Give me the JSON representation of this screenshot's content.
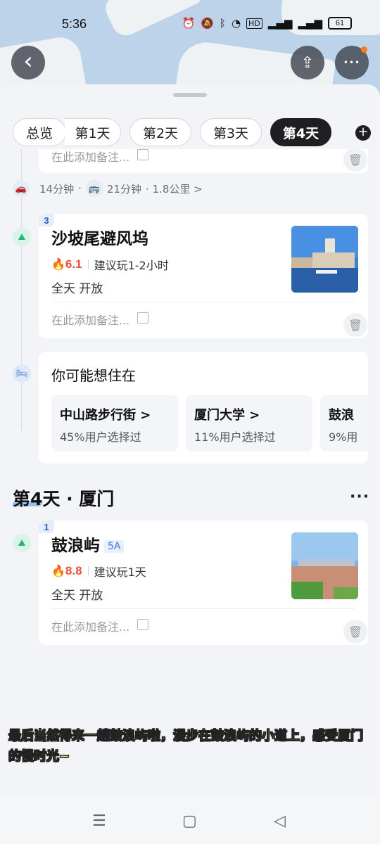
{
  "status_bar": {
    "time": "5:36",
    "icons": [
      "alarm-icon",
      "mute-icon",
      "bluetooth-icon",
      "wifi-icon",
      "hd-icon",
      "4g-signal-icon",
      "5g-signal-icon"
    ],
    "hd": "HD",
    "battery": "61"
  },
  "header": {
    "back_icon": "‹",
    "share_icon": "⇪",
    "more_icon": "•••"
  },
  "tabs": {
    "items": [
      {
        "label": "总览"
      },
      {
        "label": "第1天"
      },
      {
        "label": "第2天"
      },
      {
        "label": "第3天"
      },
      {
        "label": "第4天"
      }
    ],
    "active_index": 4,
    "add_label": "+"
  },
  "prev_card": {
    "note_placeholder": "在此添加备注..."
  },
  "transport": {
    "car_time": "14分钟",
    "dot1": "·",
    "bus_time": "21分钟",
    "distance": "· 1.8公里 >"
  },
  "poi1": {
    "index": "3",
    "title": "沙坡尾避风坞",
    "score": "6.1",
    "suggest": "建议玩1-2小时",
    "hours": "全天 开放",
    "note_placeholder": "在此添加备注..."
  },
  "hotel": {
    "title": "你可能想住在",
    "options": [
      {
        "name": "中山路步行街 >",
        "sub": "45%用户选择过"
      },
      {
        "name": "厦门大学 >",
        "sub": "11%用户选择过"
      },
      {
        "name": "鼓浪",
        "sub": "9%用"
      }
    ]
  },
  "day": {
    "header": "第4天 · 厦门",
    "more": "···"
  },
  "poi2": {
    "index": "1",
    "title": "鼓浪屿",
    "level": "5A",
    "score": "8.8",
    "suggest": "建议玩1天",
    "hours": "全天 开放",
    "note_placeholder": "在此添加备注..."
  },
  "caption": "最后当然得来一趟鼓浪屿啦，漫步在鼓浪屿的小道上，感受厦门的慢时光~",
  "nav": {
    "menu": "☰",
    "home": "▢",
    "back": "◁"
  },
  "colors": {
    "accent_blue": "#3a7bdc",
    "score_red": "#ee4d3e",
    "active_tab": "#1f1f21",
    "caption_yellow": "#ffe25a"
  }
}
